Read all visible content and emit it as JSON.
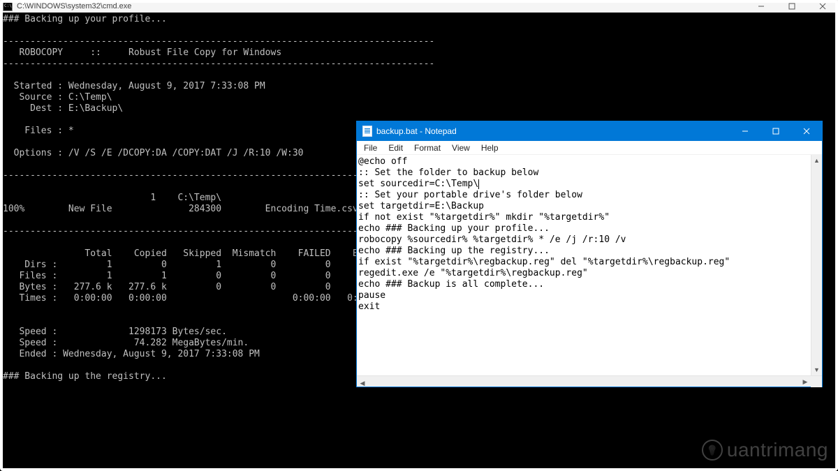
{
  "cmd": {
    "title": "C:\\WINDOWS\\system32\\cmd.exe",
    "content": "### Backing up your profile...\n\n-------------------------------------------------------------------------------\n   ROBOCOPY     ::     Robust File Copy for Windows\n-------------------------------------------------------------------------------\n\n  Started : Wednesday, August 9, 2017 7:33:08 PM\n   Source : C:\\Temp\\\n     Dest : E:\\Backup\\\n\n    Files : *\n\n  Options : /V /S /E /DCOPY:DA /COPY:DAT /J /R:10 /W:30\n\n------------------------------------------------------------------------------\n\n                           1    C:\\Temp\\\n100%        New File              284300        Encoding Time.csv\n\n------------------------------------------------------------------------------\n\n               Total    Copied   Skipped  Mismatch    FAILED    Extras\n    Dirs :         1         0         1         0         0         0\n   Files :         1         1         0         0         0         0\n   Bytes :   277.6 k   277.6 k         0         0         0         0\n   Times :   0:00:00   0:00:00                       0:00:00   0:00:00\n\n\n   Speed :             1298173 Bytes/sec.\n   Speed :              74.282 MegaBytes/min.\n   Ended : Wednesday, August 9, 2017 7:33:08 PM\n\n### Backing up the registry...\n"
  },
  "notepad": {
    "title": "backup.bat - Notepad",
    "menu": {
      "file": "File",
      "edit": "Edit",
      "format": "Format",
      "view": "View",
      "help": "Help"
    },
    "lines": [
      "@echo off",
      ":: Set the folder to backup below",
      "set sourcedir=C:\\Temp\\",
      ":: Set your portable drive's folder below",
      "set targetdir=E:\\Backup",
      "if not exist \"%targetdir%\" mkdir \"%targetdir%\"",
      "echo ### Backing up your profile...",
      "robocopy %sourcedir% %targetdir% * /e /j /r:10 /v",
      "echo ### Backing up the registry...",
      "if exist \"%targetdir%\\regbackup.reg\" del \"%targetdir%\\regbackup.reg\"",
      "regedit.exe /e \"%targetdir%\\regbackup.reg\"",
      "echo ### Backup is all complete...",
      "pause",
      "exit"
    ],
    "cursor_line_index": 2
  },
  "watermark": "uantrimang"
}
